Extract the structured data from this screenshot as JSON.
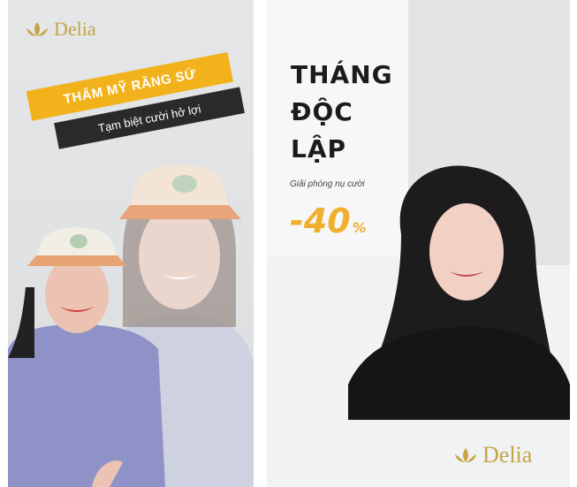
{
  "left_ad": {
    "logo_text": "Delia",
    "headline": "THẨM MỸ RĂNG SỨ",
    "subline": "Tạm biệt cười hở lợi"
  },
  "right_ad": {
    "headline_lines": [
      "THÁNG",
      "ĐỘC",
      "LẬP"
    ],
    "tagline": "Giải phóng nụ cười",
    "discount_value": "-40",
    "discount_unit": "%",
    "logo_text": "Delia"
  },
  "colors": {
    "gold": "#f2b21c",
    "logo_gold": "#c7a545",
    "dark_banner": "#2a2a2c",
    "discount_orange": "#f0b02e"
  }
}
